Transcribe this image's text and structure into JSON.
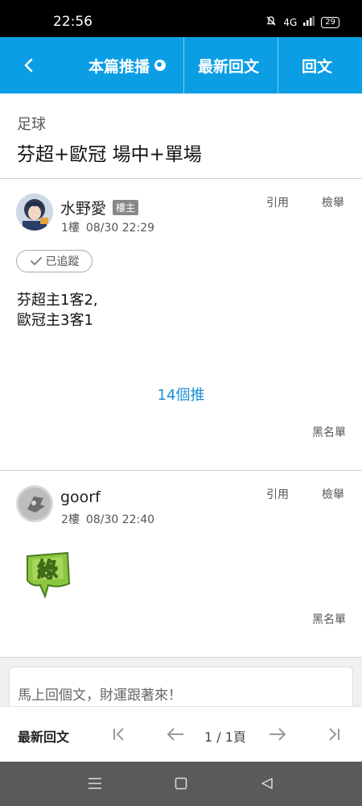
{
  "status": {
    "time": "22:56",
    "network": "4G",
    "battery": "29"
  },
  "topbar": {
    "tab_push": "本篇推播",
    "tab_latest": "最新回文",
    "tab_reply": "回文"
  },
  "thread": {
    "category": "足球",
    "title": "芬超+歐冠 場中+單場"
  },
  "posts": [
    {
      "username": "水野愛",
      "badge": "樓主",
      "floor": "1樓",
      "time": "08/30 22:29",
      "quote": "引用",
      "report": "檢舉",
      "tracked": "已追蹤",
      "body_lines": [
        "芬超主1客2,",
        "歐冠主3客1"
      ],
      "push_count": "14個推",
      "blacklist": "黑名單"
    },
    {
      "username": "goorf",
      "floor": "2樓",
      "time": "08/30 22:40",
      "quote": "引用",
      "report": "檢舉",
      "sticker": "綠",
      "blacklist": "黑名單"
    }
  ],
  "compose": {
    "placeholder": "馬上回個文，財運跟著來！"
  },
  "pager": {
    "latest": "最新回文",
    "page": "1 / 1頁"
  },
  "colors": {
    "accent": "#0b9ee4",
    "link": "#1a8fd3"
  }
}
